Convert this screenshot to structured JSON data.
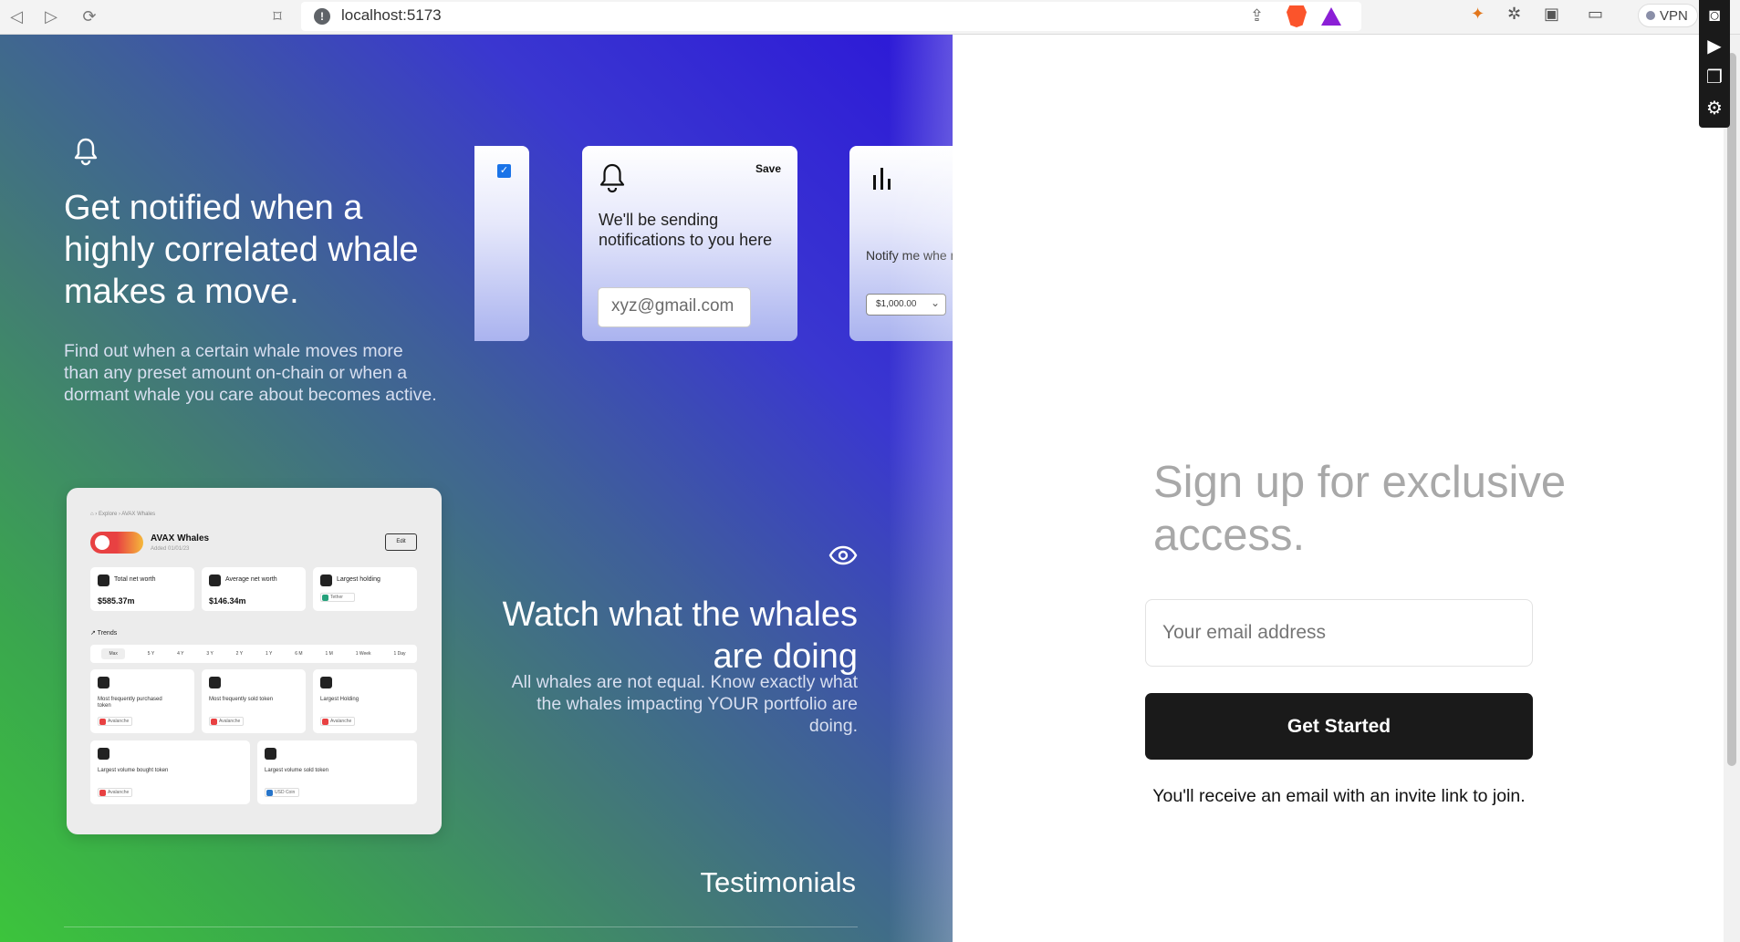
{
  "browser": {
    "url": "localhost:5173",
    "vpn_label": "VPN",
    "info_glyph": "!"
  },
  "hero": {
    "notify_title": "Get notified when a highly correlated whale makes a move.",
    "notify_desc": "Find out when a certain whale moves more than any preset amount on-chain or when a dormant whale you care about becomes active.",
    "card_notify": {
      "save_label": "Save",
      "text": "We'll be sending notifications to you here",
      "email_value": "xyz@gmail.com"
    },
    "card_threshold": {
      "text": "Notify me whe move more tha",
      "select_value": "$1,000.00"
    },
    "watch_title": "Watch what the whales are doing",
    "watch_desc": "All whales are not equal. Know exactly what the whales impacting YOUR portfolio are doing.",
    "testimonials_label": "Testimonials"
  },
  "dashboard": {
    "breadcrumb": "⌂ › Explore › AVAX Whales",
    "title": "AVAX Whales",
    "subtitle": "Added 01/01/23",
    "edit_label": "Edit",
    "stats": [
      {
        "label": "Total net worth",
        "value": "$585.37m"
      },
      {
        "label": "Average net worth",
        "value": "$146.34m"
      },
      {
        "label": "Largest holding",
        "value": "Tether"
      }
    ],
    "trends_label": "↗ Trends",
    "ranges": [
      "Max",
      "5 Y",
      "4 Y",
      "3 Y",
      "2 Y",
      "1 Y",
      "6 M",
      "1 M",
      "1 Week",
      "1 Day"
    ],
    "tiles": [
      {
        "label": "Most frequently purchased token",
        "tag": "Avalanche"
      },
      {
        "label": "Most frequently sold token",
        "tag": "Avalanche"
      },
      {
        "label": "Largest Holding",
        "tag": "Avalanche"
      },
      {
        "label": "Largest volume bought token",
        "tag": "Avalanche"
      },
      {
        "label": "Largest volume sold token",
        "tag": "USD Coin"
      }
    ]
  },
  "signup": {
    "heading": "Sign up for exclusive access.",
    "email_placeholder": "Your email address",
    "button_label": "Get Started",
    "note": "You'll receive an email with an invite link to join."
  },
  "colors": {
    "gradient_green": "#3cc43c",
    "gradient_blue": "#2c17d8",
    "button_dark": "#1a1a1a",
    "heading_gray": "#a8a8a8"
  }
}
